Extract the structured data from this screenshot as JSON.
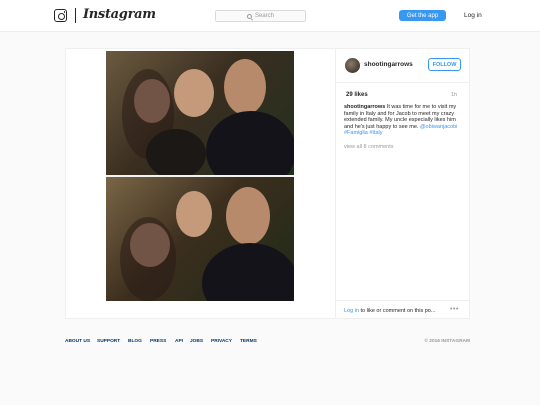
{
  "header": {
    "logo_text": "Instagram",
    "search_placeholder": "Search",
    "get_app_label": "Get the app",
    "login_label": "Log in"
  },
  "post": {
    "username": "shootingarrows",
    "follow_label": "FOLLOW",
    "likes": "29 likes",
    "time_ago": "1h",
    "caption_user": "shootingarrows",
    "caption_text": " It was time for me to visit my family in Italy and for Jacob to meet my crazy extended family. My uncle especially likes him and he's just happy to see me. ",
    "caption_mention": "@obiwanjacobi",
    "caption_tag1": "#Famiglia",
    "caption_tag2": "#Italy",
    "view_all_comments": "view all 8 comments",
    "login_link": "Log in",
    "login_comment_rest": " to like or comment on this po...",
    "more_icon": "•••"
  },
  "footer": {
    "links": [
      "ABOUT US",
      "SUPPORT",
      "BLOG",
      "PRESS",
      "API",
      "JOBS",
      "PRIVACY",
      "TERMS"
    ],
    "copyright": "© 2016 INSTAGRAM"
  },
  "colors": {
    "accent": "#3897f0",
    "footer_link": "#003569",
    "text": "#262626",
    "muted": "#999999"
  }
}
